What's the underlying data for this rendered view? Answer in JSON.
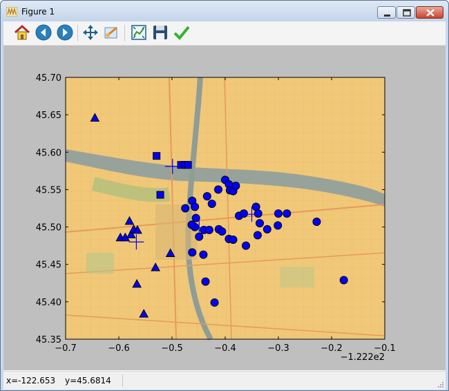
{
  "window": {
    "title": "Figure 1"
  },
  "toolbar": {
    "tools": [
      {
        "name": "home-icon",
        "color": "#c0392b"
      },
      {
        "name": "back-arrow-icon",
        "color": "#2a7fbf"
      },
      {
        "name": "forward-arrow-icon",
        "color": "#2a7fbf"
      },
      {
        "name": "pan-icon",
        "color": "#1b5e8c"
      },
      {
        "name": "zoom-rect-icon",
        "color": "#3d8fd1"
      },
      {
        "name": "subplots-config-icon",
        "color": "#3b8a3b"
      },
      {
        "name": "save-icon",
        "color": "#2b4e72"
      },
      {
        "name": "edit-check-icon",
        "color": "#2fb52f"
      }
    ]
  },
  "status": {
    "x_text": "x=-122.653",
    "y_text": "y=45.6814"
  },
  "chart_data": {
    "type": "scatter",
    "title": "",
    "xlabel": "",
    "ylabel": "",
    "xlim": [
      -0.7,
      -0.1
    ],
    "ylim": [
      45.35,
      45.7
    ],
    "x_offset_label": "−1.222e2",
    "x_ticks": [
      -0.7,
      -0.6,
      -0.5,
      -0.4,
      -0.3,
      -0.2,
      -0.1
    ],
    "x_tick_labels": [
      "−0.7",
      "−0.6",
      "−0.5",
      "−0.4",
      "−0.3",
      "−0.2",
      "−0.1"
    ],
    "y_ticks": [
      45.35,
      45.4,
      45.45,
      45.5,
      45.55,
      45.6,
      45.65,
      45.7
    ],
    "y_tick_labels": [
      "45.35",
      "45.40",
      "45.45",
      "45.50",
      "45.55",
      "45.60",
      "45.65",
      "45.70"
    ],
    "grid": false,
    "background": "street map of Portland",
    "marker_color": "#0000ff",
    "series": [
      {
        "marker": "circle",
        "points": [
          [
            -0.462,
            45.535
          ],
          [
            -0.475,
            45.525
          ],
          [
            -0.457,
            45.527
          ],
          [
            -0.455,
            45.512
          ],
          [
            -0.457,
            45.5
          ],
          [
            -0.434,
            45.541
          ],
          [
            -0.425,
            45.531
          ],
          [
            -0.44,
            45.496
          ],
          [
            -0.43,
            45.496
          ],
          [
            -0.412,
            45.497
          ],
          [
            -0.406,
            45.494
          ],
          [
            -0.413,
            45.55
          ],
          [
            -0.4,
            45.563
          ],
          [
            -0.393,
            45.557
          ],
          [
            -0.391,
            45.549
          ],
          [
            -0.385,
            45.548
          ],
          [
            -0.38,
            45.555
          ],
          [
            -0.393,
            45.484
          ],
          [
            -0.385,
            45.483
          ],
          [
            -0.374,
            45.515
          ],
          [
            -0.365,
            45.518
          ],
          [
            -0.361,
            45.475
          ],
          [
            -0.342,
            45.527
          ],
          [
            -0.339,
            45.489
          ],
          [
            -0.338,
            45.518
          ],
          [
            -0.335,
            45.505
          ],
          [
            -0.321,
            45.497
          ],
          [
            -0.301,
            45.502
          ],
          [
            -0.3,
            45.518
          ],
          [
            -0.284,
            45.518
          ],
          [
            -0.228,
            45.507
          ],
          [
            -0.177,
            45.429
          ],
          [
            -0.449,
            45.487
          ],
          [
            -0.462,
            45.466
          ],
          [
            -0.441,
            45.463
          ],
          [
            -0.437,
            45.427
          ],
          [
            -0.42,
            45.399
          ],
          [
            -0.463,
            45.503
          ]
        ]
      },
      {
        "marker": "square",
        "points": [
          [
            -0.529,
            45.595
          ],
          [
            -0.483,
            45.583
          ],
          [
            -0.475,
            45.583
          ],
          [
            -0.47,
            45.583
          ],
          [
            -0.522,
            45.543
          ]
        ]
      },
      {
        "marker": "triangle",
        "points": [
          [
            -0.645,
            45.646
          ],
          [
            -0.58,
            45.508
          ],
          [
            -0.577,
            45.49
          ],
          [
            -0.572,
            45.497
          ],
          [
            -0.565,
            45.496
          ],
          [
            -0.597,
            45.486
          ],
          [
            -0.588,
            45.486
          ],
          [
            -0.566,
            45.424
          ],
          [
            -0.553,
            45.384
          ],
          [
            -0.531,
            45.446
          ],
          [
            -0.503,
            45.465
          ]
        ]
      },
      {
        "marker": "plus",
        "points": [
          [
            -0.499,
            45.581
          ],
          [
            -0.567,
            45.48
          ],
          [
            -0.449,
            45.499
          ],
          [
            -0.35,
            45.517
          ]
        ]
      }
    ]
  }
}
